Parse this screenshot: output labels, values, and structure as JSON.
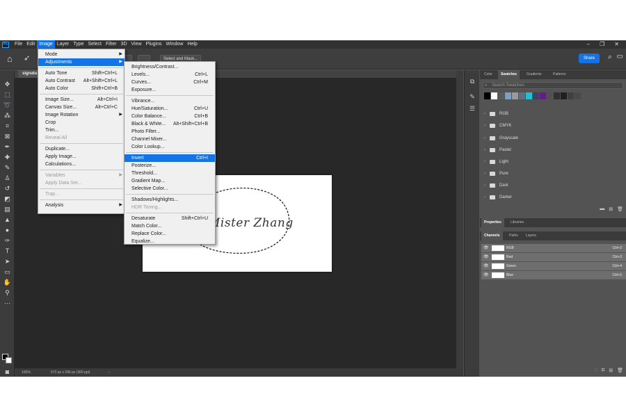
{
  "menubar": {
    "logo": "Ps",
    "items": [
      "File",
      "Edit",
      "Image",
      "Layer",
      "Type",
      "Select",
      "Filter",
      "3D",
      "View",
      "Plugins",
      "Window",
      "Help"
    ],
    "active": "Image",
    "window_controls": [
      "–",
      "❐",
      "✕"
    ]
  },
  "options_bar": {
    "select_mask_label": "Select and Mask...",
    "share_label": "Share"
  },
  "document": {
    "tab_title": "signatu",
    "signature_text": "Mister Zhang"
  },
  "status_bar": {
    "zoom": "100%",
    "doc_size": "573 px x 296 px (300 ppi)"
  },
  "image_menu": [
    {
      "label": "Mode",
      "submenu": true
    },
    {
      "label": "Adjustments",
      "submenu": true,
      "highlighted": true
    },
    {
      "sep": true
    },
    {
      "label": "Auto Tone",
      "shortcut": "Shift+Ctrl+L"
    },
    {
      "label": "Auto Contrast",
      "shortcut": "Alt+Shift+Ctrl+L"
    },
    {
      "label": "Auto Color",
      "shortcut": "Shift+Ctrl+B"
    },
    {
      "sep": true
    },
    {
      "label": "Image Size...",
      "shortcut": "Alt+Ctrl+I"
    },
    {
      "label": "Canvas Size...",
      "shortcut": "Alt+Ctrl+C"
    },
    {
      "label": "Image Rotation",
      "submenu": true
    },
    {
      "label": "Crop"
    },
    {
      "label": "Trim..."
    },
    {
      "label": "Reveal All",
      "disabled": true
    },
    {
      "sep": true
    },
    {
      "label": "Duplicate..."
    },
    {
      "label": "Apply Image..."
    },
    {
      "label": "Calculations..."
    },
    {
      "sep": true
    },
    {
      "label": "Variables",
      "submenu": true,
      "disabled": true
    },
    {
      "label": "Apply Data Set...",
      "disabled": true
    },
    {
      "sep": true
    },
    {
      "label": "Trap...",
      "disabled": true
    },
    {
      "sep": true
    },
    {
      "label": "Analysis",
      "submenu": true
    }
  ],
  "adjustments_menu": [
    {
      "label": "Brightness/Contrast..."
    },
    {
      "label": "Levels...",
      "shortcut": "Ctrl+L"
    },
    {
      "label": "Curves...",
      "shortcut": "Ctrl+M"
    },
    {
      "label": "Exposure..."
    },
    {
      "sep": true
    },
    {
      "label": "Vibrance..."
    },
    {
      "label": "Hue/Saturation...",
      "shortcut": "Ctrl+U"
    },
    {
      "label": "Color Balance...",
      "shortcut": "Ctrl+B"
    },
    {
      "label": "Black & White...",
      "shortcut": "Alt+Shift+Ctrl+B"
    },
    {
      "label": "Photo Filter..."
    },
    {
      "label": "Channel Mixer..."
    },
    {
      "label": "Color Lookup..."
    },
    {
      "sep": true
    },
    {
      "label": "Invert",
      "shortcut": "Ctrl+I",
      "highlighted": true
    },
    {
      "label": "Posterize..."
    },
    {
      "label": "Threshold..."
    },
    {
      "label": "Gradient Map..."
    },
    {
      "label": "Selective Color..."
    },
    {
      "sep": true
    },
    {
      "label": "Shadows/Highlights..."
    },
    {
      "label": "HDR Toning...",
      "disabled": true
    },
    {
      "sep": true
    },
    {
      "label": "Desaturate",
      "shortcut": "Shift+Ctrl+U"
    },
    {
      "label": "Match Color..."
    },
    {
      "label": "Replace Color..."
    },
    {
      "label": "Equalize..."
    }
  ],
  "swatches_panel": {
    "tabs": [
      "Color",
      "Swatches",
      "Gradients",
      "Patterns"
    ],
    "active_tab": "Swatches",
    "search_placeholder": "Search Swatches",
    "recent_colors": [
      "#000000",
      "#ffffff",
      "#5a5a5a",
      "#7f9fbf",
      "#9a9a9a",
      "#5f6f7f",
      "#20c0d0",
      "#404060",
      "#602080",
      "#505050",
      "#303030",
      "#202020",
      "#404040",
      "#4a4a4a"
    ],
    "groups": [
      "RGB",
      "CMYK",
      "Grayscale",
      "Pastel",
      "Light",
      "Pure",
      "Dark",
      "Darker"
    ]
  },
  "properties_panel": {
    "tabs": [
      "Properties",
      "Libraries"
    ],
    "active_tab": "Properties"
  },
  "channels_panel": {
    "tabs": [
      "Channels",
      "Paths",
      "Layers"
    ],
    "active_tab": "Channels",
    "rows": [
      {
        "name": "RGB",
        "shortcut": "Ctrl+2"
      },
      {
        "name": "Red",
        "shortcut": "Ctrl+3"
      },
      {
        "name": "Green",
        "shortcut": "Ctrl+4"
      },
      {
        "name": "Blue",
        "shortcut": "Ctrl+5"
      }
    ]
  },
  "icons": {
    "tools": [
      "move-icon",
      "marquee-icon",
      "lasso-icon",
      "magic-wand-icon",
      "crop-icon",
      "frame-icon",
      "eyedropper-icon",
      "healing-icon",
      "brush-icon",
      "clone-stamp-icon",
      "history-brush-icon",
      "eraser-icon",
      "gradient-icon",
      "blur-icon",
      "dodge-icon",
      "pen-icon",
      "type-icon",
      "path-select-icon",
      "rectangle-icon",
      "hand-icon",
      "zoom-icon",
      "more-tools-icon"
    ]
  }
}
